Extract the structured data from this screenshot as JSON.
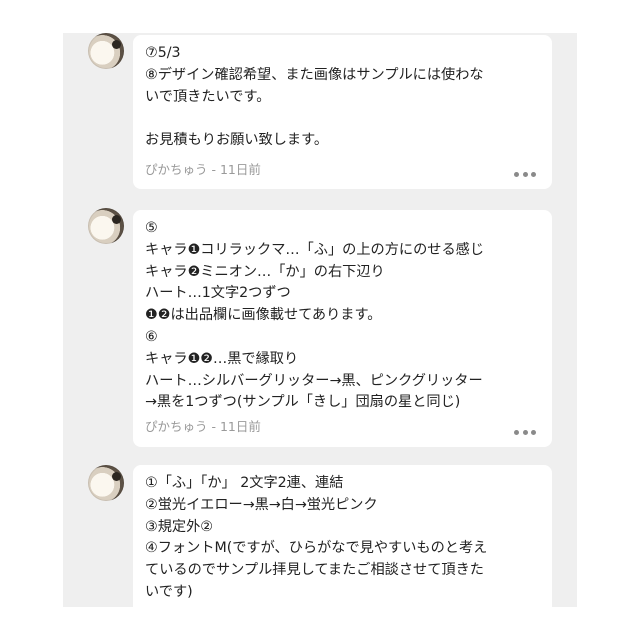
{
  "comments": [
    {
      "text": "⑦5/3\n⑧デザイン確認希望、また画像はサンプルには使わな\nいで頂きたいです。\n\nお見積もりお願い致します。",
      "author": "ぴかちゅう",
      "time": "11日前",
      "more_icon": "more-horizontal-icon"
    },
    {
      "text": "⑤\nキャラ❶コリラックマ…「ふ」の上の方にのせる感じ\nキャラ❷ミニオン…「か」の右下辺り\nハート…1文字2つずつ\n❶❷は出品欄に画像載せてあります。\n⑥\nキャラ❶❷…黒で縁取り\nハート…シルバーグリッター→黒、ピンクグリッター\n→黒を1つずつ(サンプル「きし」団扇の星と同じ)",
      "author": "ぴかちゅう",
      "time": "11日前",
      "more_icon": "more-horizontal-icon"
    },
    {
      "text": "①「ふ」「か」 2文字2連、連結\n②蛍光イエロー→黒→白→蛍光ピンク\n③規定外②\n④フォントM(ですが、ひらがなで見やすいものと考え\nているのでサンプル拝見してまたご相談させて頂きた\nいです)",
      "author": "",
      "time": "",
      "more_icon": ""
    }
  ],
  "meta_separator": " - "
}
